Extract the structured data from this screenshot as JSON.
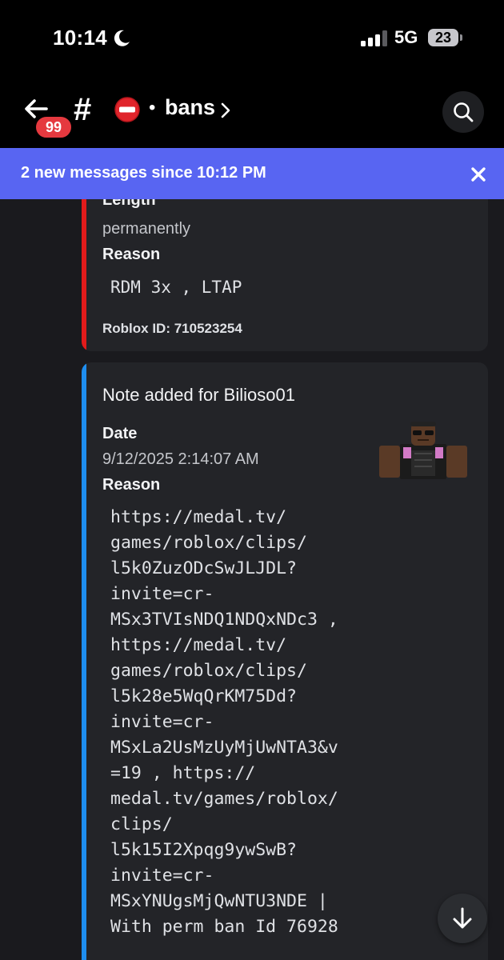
{
  "status_bar": {
    "time": "10:14",
    "network": "5G",
    "battery": "23",
    "icons": [
      "moon-icon",
      "signal-icon",
      "battery-icon"
    ]
  },
  "header": {
    "back_badge": "99",
    "channel_emoji_icon": "no-entry-icon",
    "channel_separator": "•",
    "channel_name": "bans",
    "icons": [
      "back-arrow-icon",
      "hash-icon",
      "chevron-right-icon",
      "search-icon"
    ]
  },
  "banner": {
    "text": "2 new messages since 10:12 PM",
    "icon": "close-icon",
    "color": "#5865f2"
  },
  "embeds": [
    {
      "accent_color": "#e21b1b",
      "length_label": "Length",
      "length_value": "permanently",
      "reason_label": "Reason",
      "reason_value": "RDM 3x , LTAP",
      "footer": "Roblox ID: 710523254"
    },
    {
      "accent_color": "#1e8ef0",
      "title": "Note added for Bilioso01",
      "date_label": "Date",
      "date_value": "9/12/2025 2:14:07 AM",
      "reason_label": "Reason",
      "reason_lines": [
        "https://medal.tv/",
        "games/roblox/clips/",
        "l5k0ZuzODcSwJLJDL?",
        "invite=cr-",
        "MSx3TVIsNDQ1NDQxNDc3 ,",
        "https://medal.tv/",
        "games/roblox/clips/",
        "l5k28e5WqQrKM75Dd?",
        "invite=cr-",
        "MSxLa2UsMzUyMjUwNTA3&v",
        "=19 , https://",
        "medal.tv/games/roblox/",
        "clips/",
        "l5k15I2Xpqg9ywSwB?",
        "invite=cr-",
        "MSxYNUgsMjQwNTU3NDE |",
        "With perm ban Id 76928"
      ],
      "thumbnail": "roblox-avatar-image"
    }
  ],
  "floating": {
    "icon": "arrow-down-icon"
  }
}
